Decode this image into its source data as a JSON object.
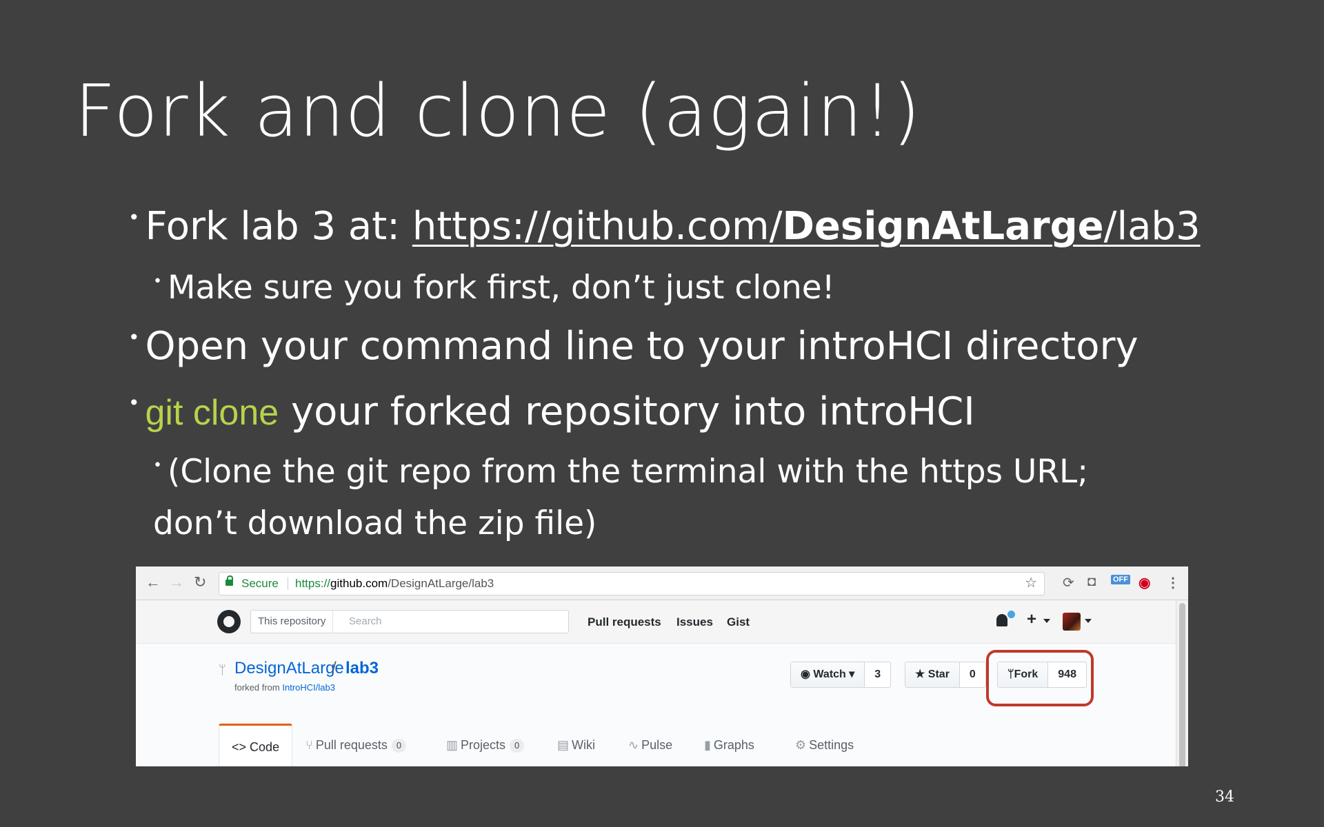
{
  "slide": {
    "title": "Fork and clone (again!)",
    "bullets": {
      "b1_prefix": "Fork lab 3 at: ",
      "b1_url_start": "https://github.com/",
      "b1_url_bold": "DesignAtLarge",
      "b1_url_end": "/lab3",
      "b1a": "Make sure you fork first, don’t just clone!",
      "b2": "Open your command line to your introHCI directory",
      "b3_code": "git clone",
      "b3_rest": " your forked repository into introHCI",
      "b3a": "(Clone the git repo from the terminal with the https URL; don’t download the zip file)"
    },
    "bullet_glyph": "•",
    "code_color": "#b6d34c",
    "page_number": "34"
  },
  "browser": {
    "nav_back": "←",
    "nav_forward": "→",
    "nav_reload": "↻",
    "secure_label": "Secure",
    "url_scheme": "https://",
    "url_host": "github.com",
    "url_path": "/DesignAtLarge/lab3",
    "bookmark_icon": "☆",
    "ext_off_label": "OFF",
    "menu_icon": "⋮"
  },
  "github": {
    "search_scope": "This repository",
    "search_placeholder": "Search",
    "nav": [
      "Pull requests",
      "Issues",
      "Gist"
    ],
    "plus": "+",
    "repo_owner": "DesignAtLarge",
    "repo_slash": "/",
    "repo_name": "lab3",
    "forked_from_prefix": "forked from ",
    "forked_from_link": "IntroHCI/lab3",
    "watch_label": "Watch",
    "watch_count": "3",
    "star_label": "Star",
    "star_count": "0",
    "fork_label": "Fork",
    "fork_count": "948",
    "highlight_color": "#c0392b",
    "tabs": [
      {
        "label": "Code",
        "icon": "<>"
      },
      {
        "label": "Pull requests",
        "count": "0"
      },
      {
        "label": "Projects",
        "count": "0"
      },
      {
        "label": "Wiki"
      },
      {
        "label": "Pulse"
      },
      {
        "label": "Graphs"
      },
      {
        "label": "Settings"
      }
    ]
  }
}
